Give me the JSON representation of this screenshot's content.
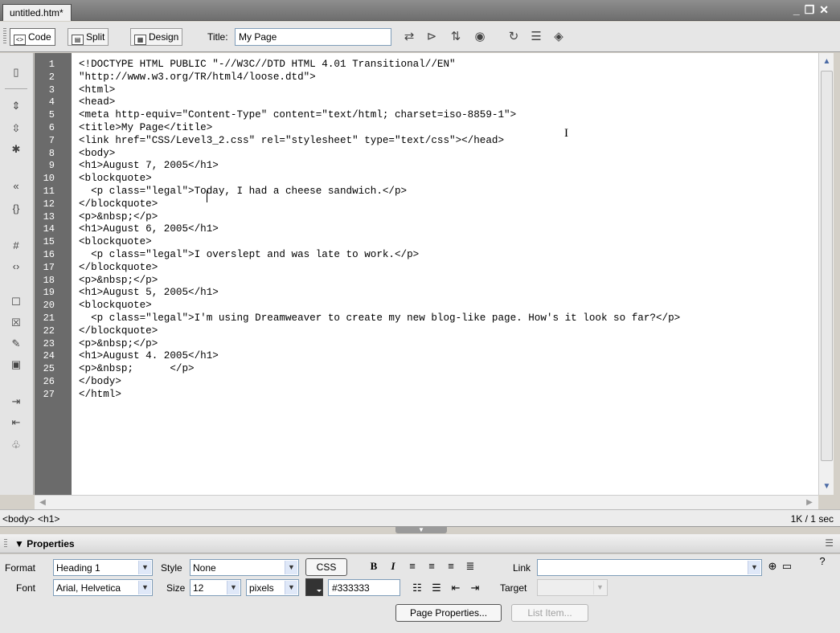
{
  "tab": {
    "title": "untitled.htm*"
  },
  "window_controls": {
    "minimize": "_",
    "restore": "❐",
    "close": "✕"
  },
  "toolbar": {
    "code_label": "Code",
    "split_label": "Split",
    "design_label": "Design",
    "title_label": "Title:",
    "title_value": "My Page"
  },
  "code": {
    "line_numbers": [
      "1",
      "2",
      "3",
      "4",
      "5",
      "6",
      "7",
      "8",
      "9",
      "10",
      "11",
      "12",
      "13",
      "14",
      "15",
      "16",
      "17",
      "18",
      "19",
      "20",
      "21",
      "22",
      "23",
      "24",
      "25",
      "26",
      "27"
    ],
    "lines": [
      "<!DOCTYPE HTML PUBLIC \"-//W3C//DTD HTML 4.01 Transitional//EN\"",
      "\"http://www.w3.org/TR/html4/loose.dtd\">",
      "<html>",
      "<head>",
      "<meta http-equiv=\"Content-Type\" content=\"text/html; charset=iso-8859-1\">",
      "<title>My Page</title>",
      "<link href=\"CSS/Level3_2.css\" rel=\"stylesheet\" type=\"text/css\"></head>",
      "<body>",
      "<h1>August 7, 2005</h1>",
      "<blockquote>",
      "  <p class=\"legal\">Today, I had a cheese sandwich.</p>",
      "</blockquote>",
      "<p>&nbsp;</p>",
      "<h1>August 6, 2005</h1>",
      "<blockquote>",
      "  <p class=\"legal\">I overslept and was late to work.</p>",
      "</blockquote>",
      "<p>&nbsp;</p>",
      "<h1>August 5, 2005</h1>",
      "<blockquote>",
      "  <p class=\"legal\">I'm using Dreamweaver to create my new blog-like page. How's it look so far?</p>",
      "</blockquote>",
      "<p>&nbsp;</p>",
      "<h1>August 4. 2005</h1>",
      "<p>&nbsp;      </p>",
      "</body>",
      "</html>"
    ]
  },
  "status": {
    "tags": [
      "<body>",
      "<h1>"
    ],
    "download": "1K / 1 sec"
  },
  "properties": {
    "header": "Properties",
    "format_label": "Format",
    "format_value": "Heading 1",
    "style_label": "Style",
    "style_value": "None",
    "css_button": "CSS",
    "bold": "B",
    "italic": "I",
    "link_label": "Link",
    "link_value": "",
    "font_label": "Font",
    "font_value": "Arial, Helvetica",
    "size_label": "Size",
    "size_value": "12",
    "unit_value": "pixels",
    "color_value": "#333333",
    "target_label": "Target",
    "target_value": "",
    "page_properties_button": "Page Properties...",
    "list_item_button": "List Item..."
  },
  "colors": {
    "text_color": "#333333",
    "gutter": "#6b6b6b"
  },
  "icons": [
    "code-view-icon",
    "split-view-icon",
    "design-view-icon",
    "validate-icon",
    "browser-check-icon",
    "file-management-icon",
    "preview-icon",
    "refresh-icon",
    "view-options-icon",
    "visual-aids-icon"
  ]
}
